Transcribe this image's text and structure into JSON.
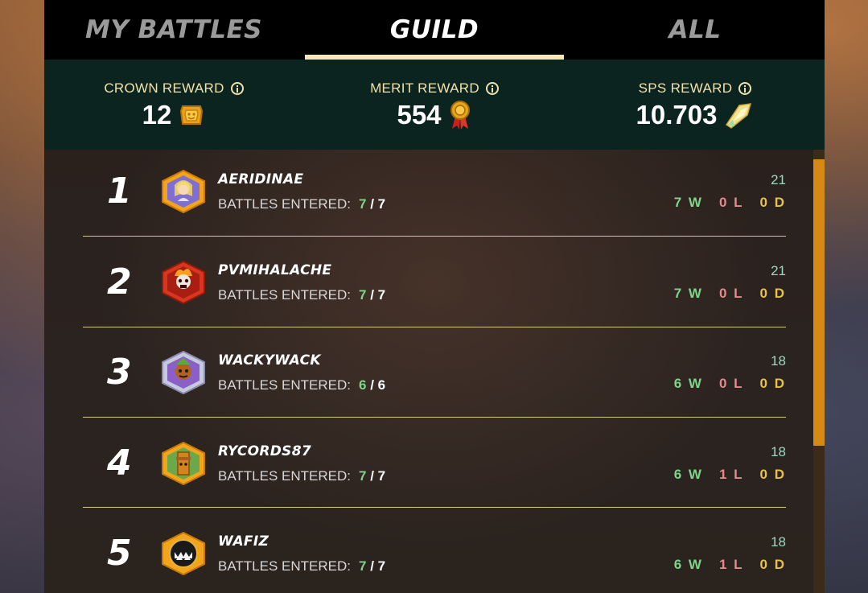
{
  "tabs": {
    "my_battles": "MY BATTLES",
    "guild": "GUILD",
    "all": "ALL"
  },
  "rewards": {
    "crown": {
      "label": "CROWN REWARD",
      "value": "12",
      "icon": "crown-token-icon"
    },
    "merit": {
      "label": "MERIT REWARD",
      "value": "554",
      "icon": "merit-medal-icon"
    },
    "sps": {
      "label": "SPS REWARD",
      "value": "10.703",
      "icon": "sps-crystal-icon"
    }
  },
  "battles_label": "BATTLES ENTERED:",
  "rows": [
    {
      "rank": "1",
      "name": "AERIDINAE",
      "entered": "7",
      "total": "7",
      "score": "21",
      "w": "7 W",
      "l": "0 L",
      "d": "0 D",
      "avatar": "angel-avatar-icon"
    },
    {
      "rank": "2",
      "name": "PVMIHALACHE",
      "entered": "7",
      "total": "7",
      "score": "21",
      "w": "7 W",
      "l": "0 L",
      "d": "0 D",
      "avatar": "fire-skull-avatar-icon"
    },
    {
      "rank": "3",
      "name": "WACKYWACK",
      "entered": "6",
      "total": "6",
      "score": "18",
      "w": "6 W",
      "l": "0 L",
      "d": "0 D",
      "avatar": "goblin-avatar-icon"
    },
    {
      "rank": "4",
      "name": "RYCORDS87",
      "entered": "7",
      "total": "7",
      "score": "18",
      "w": "6 W",
      "l": "1 L",
      "d": "0 D",
      "avatar": "totem-avatar-icon"
    },
    {
      "rank": "5",
      "name": "WAFIZ",
      "entered": "7",
      "total": "7",
      "score": "18",
      "w": "6 W",
      "l": "1 L",
      "d": "0 D",
      "avatar": "monster-mouth-avatar-icon"
    }
  ],
  "colors": {
    "win": "#7fd48a",
    "loss": "#e48a8a",
    "draw": "#e6c24a",
    "accent": "#d48a14",
    "label_gold": "#f1e2ac"
  }
}
